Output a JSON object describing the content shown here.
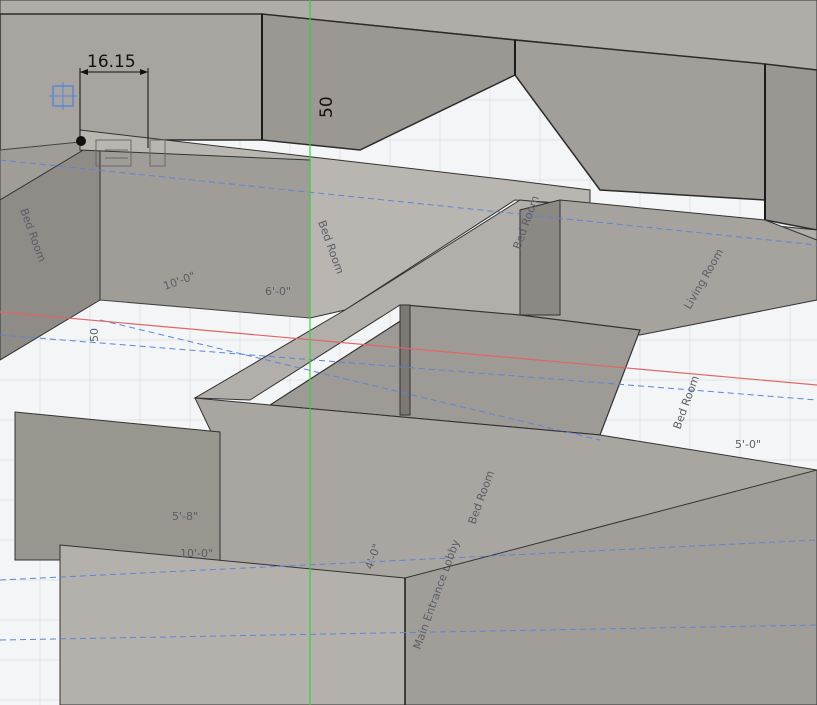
{
  "viewport": {
    "dimensions": {
      "width_value": "16.15",
      "height_value": "50",
      "side_value": "50"
    },
    "plan_labels": {
      "room_a": "Bed Room",
      "room_b": "Bed Room",
      "room_c": "Bed Room",
      "room_d": "Bed Room",
      "living": "Living Room",
      "entry": "Main Entrance Lobby"
    },
    "plan_dims": {
      "d1": "10'-0\"",
      "d2": "5'-8\"",
      "d3": "10'-0\"",
      "d4": "6'-0\"",
      "d5": "5'-0\"",
      "d6": "4'-0\""
    },
    "colors": {
      "background": "#f4f5f6",
      "floor": "#a19d98",
      "wall_light": "#b7b3ae",
      "wall_dark": "#7f7b77",
      "axis_green": "#3ad13a",
      "axis_red": "#e06666",
      "sketch_blue": "#5b86d6"
    }
  }
}
